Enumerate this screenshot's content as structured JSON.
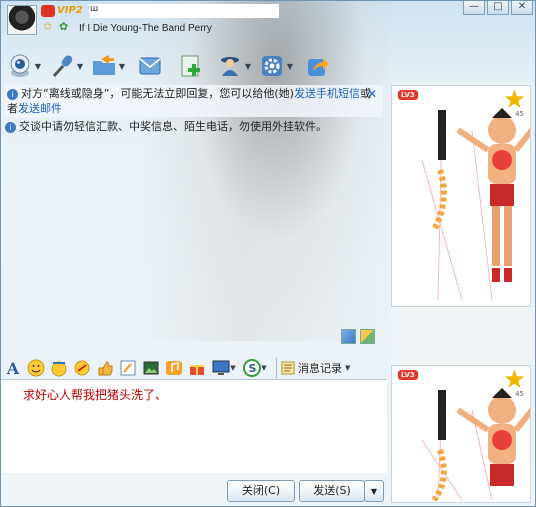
{
  "title_bar": {
    "vip_label": "VIP2",
    "username": "ш",
    "signature": "If I Die Young-The Band Perry",
    "window_buttons": [
      "—",
      "□",
      "✕"
    ]
  },
  "toolbar": {
    "buttons": [
      {
        "name": "video-call",
        "icon": "webcam-icon"
      },
      {
        "name": "voice-call",
        "icon": "microphone-icon"
      },
      {
        "name": "send-file",
        "icon": "folder-icon"
      },
      {
        "name": "send-sms",
        "icon": "mail-icon"
      },
      {
        "name": "add-app",
        "icon": "plus-icon"
      },
      {
        "name": "remote-assist",
        "icon": "person-icon"
      },
      {
        "name": "settings",
        "icon": "gear-icon"
      },
      {
        "name": "share",
        "icon": "share-icon"
      }
    ]
  },
  "chat": {
    "notice1_prefix": "对方“离线或隐身”，可能无法立即回复，您可以给他(她)",
    "notice1_link1": "发送手机短信",
    "notice1_mid": "或者",
    "notice1_link2": "发送邮件",
    "notice2": "交谈中请勿轻信汇款、中奖信息、陌生电话，勿使用外挂软件。"
  },
  "format_bar": {
    "font_glyph": "A",
    "history_label": "消息记录"
  },
  "input": {
    "text": "求好心人帮我把猪头洗了、"
  },
  "buttons": {
    "close": "关闭(C)",
    "send": "发送(S)"
  },
  "show_panel": {
    "level_badge": "LV3",
    "star_count": "45"
  },
  "colors": {
    "accent": "#1d5fb8",
    "input_text": "#c00000",
    "badge": "#e03a2f"
  }
}
